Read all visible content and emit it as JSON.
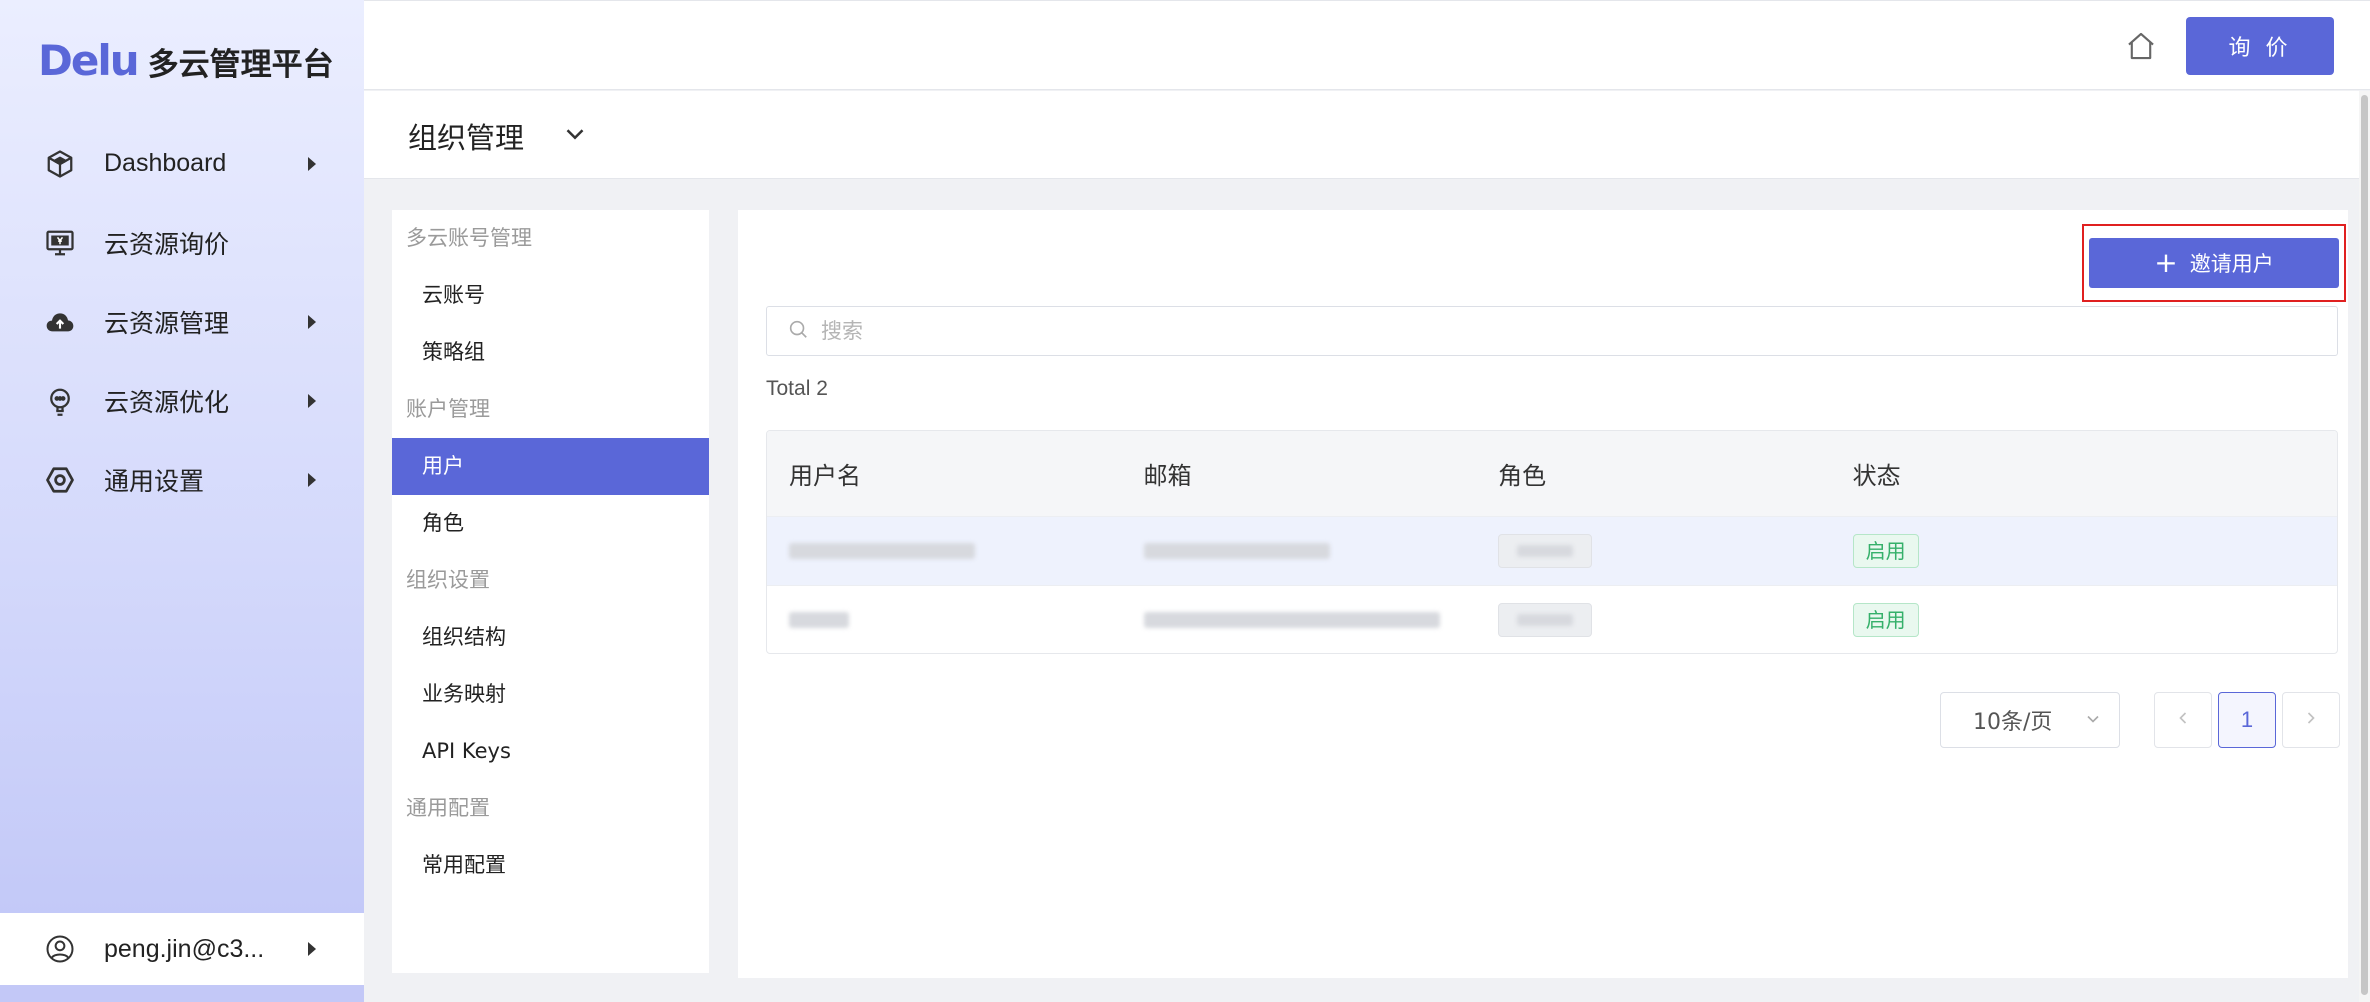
{
  "brand": {
    "mark": "Delu",
    "name": "多云管理平台"
  },
  "colors": {
    "accent": "#5a67d8",
    "highlight_border": "#e02020",
    "status_green": "#35b06a"
  },
  "nav": [
    {
      "label": "Dashboard",
      "icon": "cube-icon",
      "has_arrow": true
    },
    {
      "label": "云资源询价",
      "icon": "monitor-yen-icon",
      "has_arrow": false
    },
    {
      "label": "云资源管理",
      "icon": "cloud-upload-icon",
      "has_arrow": true
    },
    {
      "label": "云资源优化",
      "icon": "bulb-icon",
      "has_arrow": true
    },
    {
      "label": "通用设置",
      "icon": "hexagon-gear-icon",
      "has_arrow": true
    }
  ],
  "user": {
    "label": "peng.jin@c3...",
    "icon": "user-circle-icon"
  },
  "header": {
    "home_icon": "home-icon",
    "quote_label": "询 价"
  },
  "page": {
    "title": "组织管理",
    "chevron_icon": "chevron-down-icon"
  },
  "submenu": {
    "groups": [
      {
        "label": "多云账号管理",
        "items": [
          {
            "label": "云账号",
            "active": false
          },
          {
            "label": "策略组",
            "active": false
          }
        ]
      },
      {
        "label": "账户管理",
        "items": [
          {
            "label": "用户",
            "active": true
          },
          {
            "label": "角色",
            "active": false
          }
        ]
      },
      {
        "label": "组织设置",
        "items": [
          {
            "label": "组织结构",
            "active": false
          },
          {
            "label": "业务映射",
            "active": false
          },
          {
            "label": "API Keys",
            "active": false
          }
        ]
      },
      {
        "label": "通用配置",
        "items": [
          {
            "label": "常用配置",
            "active": false
          }
        ]
      }
    ]
  },
  "content": {
    "invite_label": "邀请用户",
    "search_placeholder": "搜索",
    "total": "Total 2",
    "columns": [
      "用户名",
      "邮箱",
      "角色",
      "状态"
    ],
    "rows": [
      {
        "status": "启用",
        "highlighted": true
      },
      {
        "status": "启用",
        "highlighted": false
      }
    ],
    "page_size": "10条/页",
    "current_page": "1"
  }
}
